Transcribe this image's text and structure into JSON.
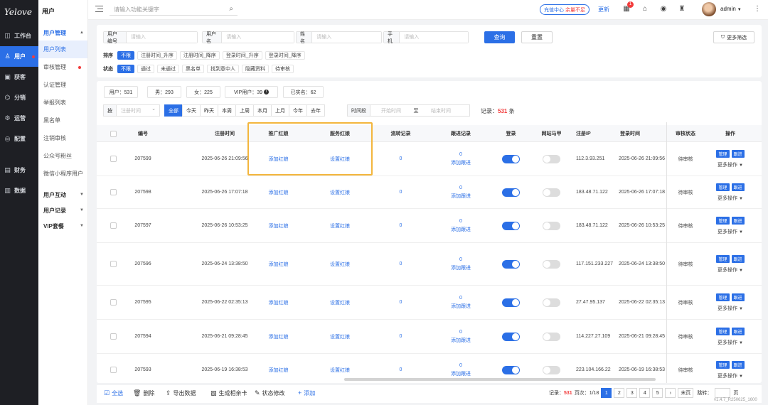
{
  "brand": "Yelove",
  "dark_nav": [
    {
      "label": "工作台",
      "icon": "dashboard-icon"
    },
    {
      "label": "用户",
      "icon": "user-icon",
      "active": true,
      "dot": true
    },
    {
      "label": "获客",
      "icon": "acquire-icon"
    },
    {
      "label": "分销",
      "icon": "share-icon"
    },
    {
      "label": "运营",
      "icon": "operation-icon"
    },
    {
      "label": "配置",
      "icon": "config-icon"
    },
    {
      "label": "财务",
      "icon": "finance-icon"
    },
    {
      "label": "数据",
      "icon": "data-icon"
    }
  ],
  "sub_nav": {
    "title": "用户",
    "group1": "用户管理",
    "items": [
      "用户列表",
      "审核管理",
      "认证管理",
      "举报列表",
      "黑名单",
      "注销审核",
      "公众号粉丝",
      "微信小程序用户"
    ],
    "group2": "用户互动",
    "group3": "用户记录",
    "group4": "VIP套餐"
  },
  "topbar": {
    "search_placeholder": "请输入功能关键字",
    "recharge": "充值中心",
    "recharge_warn": "余量不足",
    "update": "更新",
    "badge": "1",
    "user": "admin"
  },
  "filter": {
    "f1_label": "用户编号",
    "f1_ph": "请输入",
    "f2_label": "用户名",
    "f2_ph": "请输入",
    "f3_label": "姓名",
    "f3_ph": "请输入",
    "f4_label": "手机",
    "f4_ph": "请输入",
    "query": "查询",
    "reset": "重置",
    "more": "更多筛选",
    "sort_label": "排序",
    "sort_opts": [
      "不限",
      "注册时间_升序",
      "注册时间_降序",
      "登录时间_升序",
      "登录时间_降序"
    ],
    "status_label": "状态",
    "status_opts": [
      "不限",
      "通过",
      "未通过",
      "黑名单",
      "找到意中人",
      "隐藏资料",
      "待审核"
    ]
  },
  "stats": [
    "用户：531",
    "男：293",
    "女：225",
    "VIP用户：39",
    "已实名：62"
  ],
  "date_filter": {
    "by_label": "按",
    "by_value": "注册时间",
    "periods": [
      "全部",
      "今天",
      "昨天",
      "本周",
      "上周",
      "本月",
      "上月",
      "今年",
      "去年"
    ],
    "range_label": "时间段",
    "start_ph": "开始时间",
    "sep": "至",
    "end_ph": "结束时间",
    "record_label": "记录：",
    "record_count": "531",
    "record_unit": "条"
  },
  "columns": [
    "编号",
    "注册时间",
    "推广红娘",
    "服务红娘",
    "流转记录",
    "跟进记录",
    "登录",
    "网站马甲",
    "注册IP",
    "登录时间",
    "审核状态",
    "操作"
  ],
  "rows": [
    {
      "id": "207599",
      "reg": "2025-06-26 21:09:56",
      "promo": "添加红娘",
      "svc": "设置红娘",
      "flow": "0",
      "fcount": "0",
      "fadd": "添加跟进",
      "ip": "112.3.93.251",
      "login": "2025-06-26 21:09:56",
      "status": "待审核",
      "login_on": true,
      "vest_on": false
    },
    {
      "id": "207598",
      "reg": "2025-06-26 17:07:18",
      "promo": "添加红娘",
      "svc": "设置红娘",
      "flow": "0",
      "fcount": "0",
      "fadd": "添加跟进",
      "ip": "183.48.71.122",
      "login": "2025-06-26 17:07:18",
      "status": "待审核",
      "login_on": true,
      "vest_on": false
    },
    {
      "id": "207597",
      "reg": "2025-06-26 10:53:25",
      "promo": "添加红娘",
      "svc": "设置红娘",
      "flow": "0",
      "fcount": "0",
      "fadd": "添加跟进",
      "ip": "183.48.71.122",
      "login": "2025-06-26 10:53:25",
      "status": "待审核",
      "login_on": true,
      "vest_on": false
    },
    {
      "id": "207596",
      "reg": "2025-06-24 13:38:50",
      "promo": "添加红娘",
      "svc": "设置红娘",
      "flow": "0",
      "fcount": "0",
      "fadd": "添加跟进",
      "ip": "117.151.233.227",
      "login": "2025-06-24 13:38:50",
      "status": "待审核",
      "login_on": true,
      "vest_on": false
    },
    {
      "id": "207595",
      "reg": "2025-06-22 02:35:13",
      "promo": "添加红娘",
      "svc": "设置红娘",
      "flow": "0",
      "fcount": "0",
      "fadd": "添加跟进",
      "ip": "27.47.95.137",
      "login": "2025-06-22 02:35:13",
      "status": "待审核",
      "login_on": true,
      "vest_on": false
    },
    {
      "id": "207594",
      "reg": "2025-06-21 09:28:45",
      "promo": "添加红娘",
      "svc": "设置红娘",
      "flow": "0",
      "fcount": "0",
      "fadd": "添加跟进",
      "ip": "114.227.27.109",
      "login": "2025-06-21 09:28:45",
      "status": "待审核",
      "login_on": true,
      "vest_on": false
    },
    {
      "id": "207593",
      "reg": "2025-06-19 16:38:53",
      "promo": "添加红娘",
      "svc": "设置红娘",
      "flow": "0",
      "fcount": "0",
      "fadd": "添加跟进",
      "ip": "223.104.166.22",
      "login": "2025-06-19 16:38:53",
      "status": "待审核",
      "login_on": true,
      "vest_on": false
    }
  ],
  "row_ops": {
    "manage": "管理",
    "follow": "跟进",
    "more": "更多操作"
  },
  "footer": {
    "select_all": "全选",
    "delete": "删除",
    "export": "导出数据",
    "album": "生成相亲卡",
    "status_edit": "状态修改",
    "add": "添加",
    "rec_label": "记录：",
    "rec_count": "531",
    "page_label": "页次：",
    "page_pos": "1/18",
    "pages": [
      "1",
      "2",
      "3",
      "4",
      "5"
    ],
    "next": "›",
    "last": "末页",
    "jump": "跳转：",
    "page_unit": "页"
  },
  "version": "v1.4.7_R250625_1600",
  "colors": {
    "accent": "#2b6fe6",
    "danger": "#f23b3b",
    "highlight": "#f3b63d",
    "dark": "#1e1f24"
  }
}
